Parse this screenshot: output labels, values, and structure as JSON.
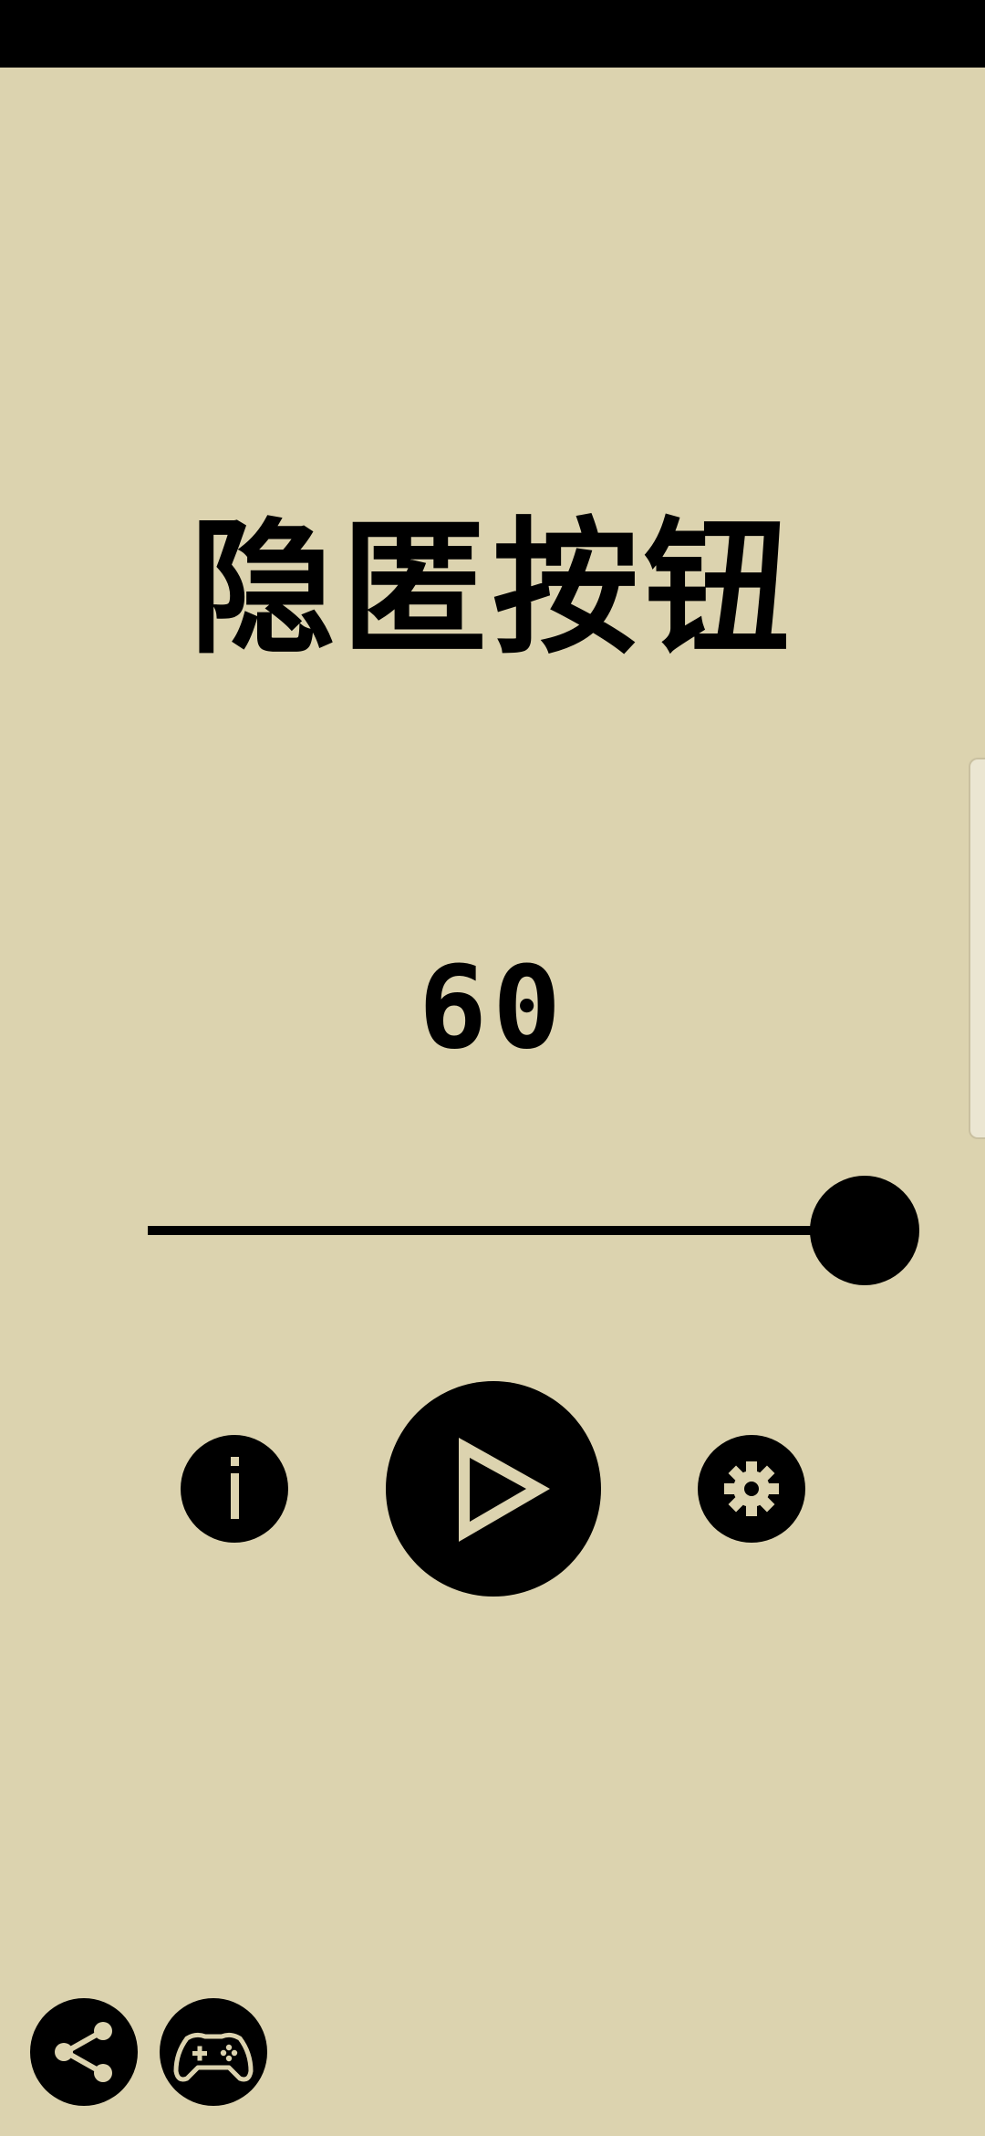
{
  "app": {
    "title": "隐匿按钮"
  },
  "counter": {
    "value": "60"
  },
  "slider": {
    "value_fraction": 1.0
  },
  "controls": {
    "info_icon": "info-icon",
    "play_icon": "play-icon",
    "settings_icon": "gear-icon"
  },
  "footer": {
    "share_icon": "share-icon",
    "games_icon": "gamepad-icon"
  },
  "colors": {
    "background": "#DCD3AF",
    "foreground": "#000000",
    "status_bar": "#000000"
  }
}
